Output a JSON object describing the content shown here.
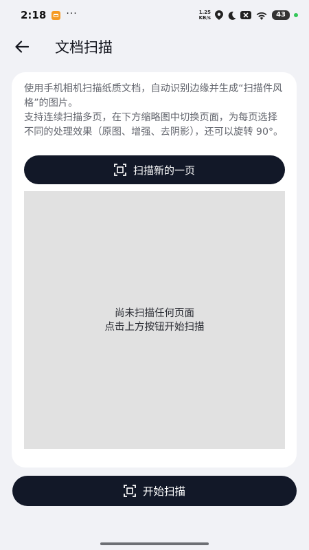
{
  "status_bar": {
    "time": "2:18",
    "dots": "···",
    "net_speed_value": "1.25",
    "net_speed_unit": "KB/s",
    "battery": "43"
  },
  "header": {
    "title": "文档扫描"
  },
  "card": {
    "description_lines": [
      "使用手机相机扫描纸质文档，自动识别边缘并生成“扫描件风格”的图片。",
      "支持连续扫描多页，在下方缩略图中切换页面，为每页选择不同的处理效果（原图、增强、去阴影），还可以旋转 90°。"
    ],
    "scan_new_label": "扫描新的一页",
    "empty_line1": "尚未扫描任何页面",
    "empty_line2": "点击上方按钮开始扫描"
  },
  "bottom": {
    "start_scan_label": "开始扫描"
  },
  "icons": {
    "back": "arrow-left-icon",
    "scan": "scan-frame-icon"
  }
}
